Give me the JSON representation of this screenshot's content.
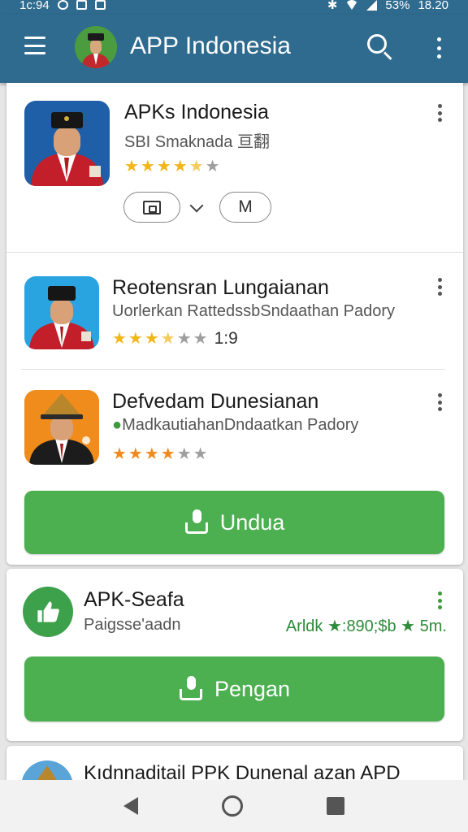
{
  "status_bar": {
    "time_left": "1c:94",
    "battery": "53%",
    "time_right": "18.20"
  },
  "app_bar": {
    "title": "APP Indonesia",
    "menu_icon": "hamburger-menu-icon",
    "search_icon": "search-icon",
    "overflow_icon": "more-vert-icon"
  },
  "featured": {
    "title": "APKs Indonesia",
    "subtitle": "SBI Smaknada 亘翻",
    "rating": 4.5,
    "chip_right_label": "M"
  },
  "list": [
    {
      "title": "Reotensran Lungaianan",
      "subtitle": "Uorlerkan RattedssbSndaathan Padory",
      "rating": 3.5,
      "count": "1:9"
    },
    {
      "title": "Defvedam Dunesianan",
      "subtitle": "MadkautiahanDndaatkan Padory",
      "rating": 4
    }
  ],
  "download_button": {
    "label": "Undua"
  },
  "card2": {
    "title": "APK-Seafa",
    "subtitle": "Paigsse'aadn",
    "meta": "Arldk ★:890;$b ★ 5m.",
    "button_label": "Pengan"
  },
  "card3": {
    "title": "Kıdnnaditail PPK Dunenal azan APD"
  },
  "colors": {
    "app_bar": "#2f6b8f",
    "button_green": "#4caf50",
    "star_gold": "#f2b619",
    "star_orange": "#f08a1c"
  },
  "nav": {
    "back_icon": "back-triangle-icon",
    "home_icon": "home-circle-icon",
    "recent_icon": "recent-square-icon"
  }
}
